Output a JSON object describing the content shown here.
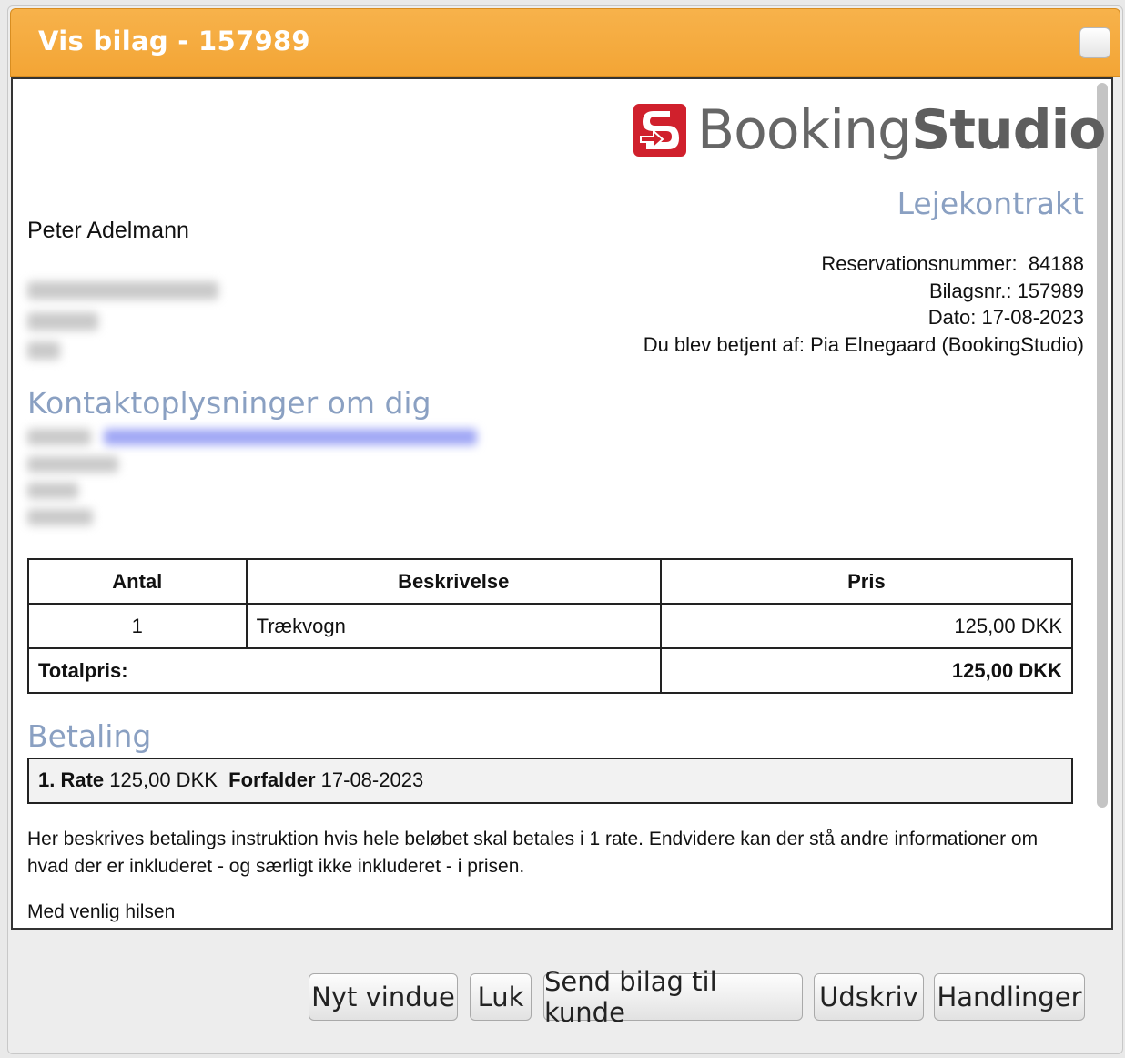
{
  "dialog": {
    "title": "Vis bilag - 157989"
  },
  "brand": {
    "name_light": "Booking",
    "name_bold": "Studio",
    "logo_color": "#d0202c"
  },
  "document": {
    "title": "Lejekontrakt",
    "customer_name": "Peter Adelmann",
    "meta": {
      "reservation": "Reservationsnummer:  84188",
      "bilag": "Bilagsnr.: 157989",
      "date": "Dato: 17-08-2023",
      "served_by": "Du blev betjent af: Pia Elnegaard (BookingStudio)"
    },
    "contact_heading": "Kontaktoplysninger om dig",
    "table": {
      "headers": [
        "Antal",
        "Beskrivelse",
        "Pris"
      ],
      "rows": [
        {
          "qty": "1",
          "description": "Trækvogn",
          "price": "125,00 DKK"
        }
      ],
      "total_label": "Totalpris:",
      "total_value": "125,00 DKK"
    },
    "payment_heading": "Betaling",
    "payment": {
      "rate_label": "1. Rate",
      "rate_amount": "125,00 DKK",
      "due_label": "Forfalder",
      "due_date": "17-08-2023"
    },
    "instructions": "Her beskrives betalings instruktion hvis hele beløbet skal betales i 1 rate. Endvidere kan der stå andre informationer om hvad der er inkluderet - og særligt ikke inkluderet - i prisen.",
    "regards": "Med venlig hilsen"
  },
  "buttons": {
    "new_window": "Nyt vindue",
    "close": "Luk",
    "send": "Send bilag til kunde",
    "print": "Udskriv",
    "actions": "Handlinger"
  },
  "colors": {
    "titlebar": "#f3a535",
    "heading": "#8aa0c2"
  }
}
